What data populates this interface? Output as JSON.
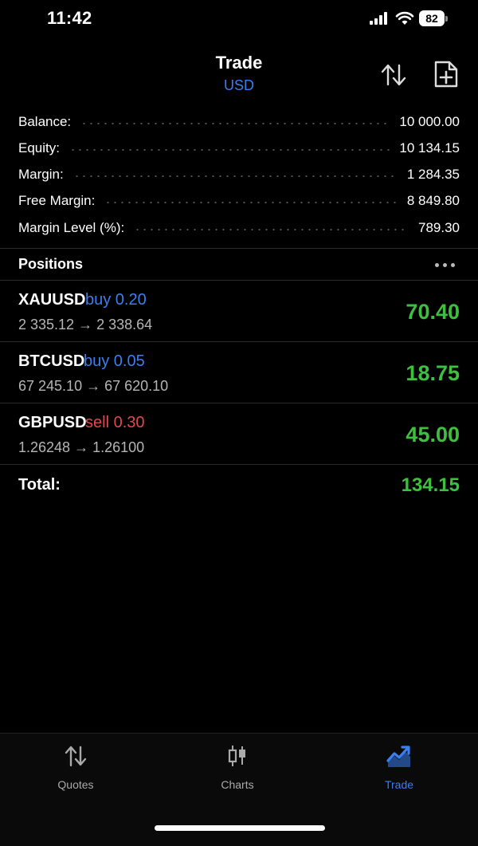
{
  "status_bar": {
    "time": "11:42",
    "battery": "82"
  },
  "header": {
    "title": "Trade",
    "subtitle": "USD",
    "sort_icon": "sort-arrows-icon",
    "new_order_icon": "new-document-icon"
  },
  "summary": [
    {
      "label": "Balance:",
      "value": "10 000.00"
    },
    {
      "label": "Equity:",
      "value": "10 134.15"
    },
    {
      "label": "Margin:",
      "value": "1 284.35"
    },
    {
      "label": "Free Margin:",
      "value": "8 849.80"
    },
    {
      "label": "Margin Level (%):",
      "value": "789.30"
    }
  ],
  "positions": {
    "title": "Positions",
    "more_icon": "more-dots-icon",
    "items": [
      {
        "symbol": "XAUUSD",
        "side": "buy 0.20",
        "prices": "2 335.12 → 2 338.64",
        "profit": "70.40"
      },
      {
        "symbol": "BTCUSD",
        "side": "buy 0.05",
        "prices": "67 245.10 → 67 620.10",
        "profit": "18.75"
      },
      {
        "symbol": "GBPUSD",
        "side": "sell 0.30",
        "prices": "1.26248 → 1.26100",
        "profit": "45.00"
      }
    ],
    "total_label": "Total:",
    "total_value": "134.15"
  },
  "tabs": [
    {
      "label": "Quotes",
      "icon": "quotes-arrows-icon"
    },
    {
      "label": "Charts",
      "icon": "candlestick-icon"
    },
    {
      "label": "Trade",
      "icon": "trade-trend-icon",
      "active": true
    }
  ],
  "colors": {
    "accent": "#3b7ef0",
    "profit": "#3fbf3f",
    "sell": "#e0484a",
    "background": "#000000"
  }
}
